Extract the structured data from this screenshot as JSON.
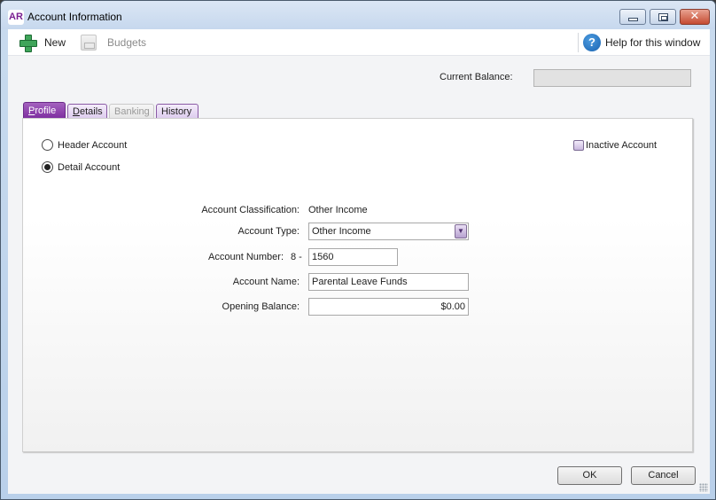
{
  "window": {
    "app_logo": "AR",
    "title": "Account Information",
    "controls": {
      "minimize": "minimize",
      "maximize": "maximize",
      "close": "✕"
    }
  },
  "toolbar": {
    "new_label": "New",
    "budgets_label": "Budgets",
    "help_label": "Help for this window",
    "help_glyph": "?"
  },
  "balance": {
    "label": "Current Balance:",
    "value": ""
  },
  "tabs": [
    {
      "label": "Profile",
      "mnemonic": "P",
      "rest": "rofile",
      "state": "active"
    },
    {
      "label": "Details",
      "mnemonic": "D",
      "rest": "etails",
      "state": "normal"
    },
    {
      "label": "Banking",
      "state": "disabled"
    },
    {
      "label": "History",
      "state": "normal"
    }
  ],
  "profile": {
    "radios": [
      {
        "label": "Header Account",
        "checked": false
      },
      {
        "label": "Detail Account",
        "checked": true
      }
    ],
    "inactive_label": "Inactive Account",
    "inactive_checked": false,
    "classification_label": "Account Classification:",
    "classification_value": "Other Income",
    "type_label": "Account Type:",
    "type_value": "Other Income",
    "number_label": "Account Number:",
    "number_prefix": "8 -",
    "number_value": "1560",
    "name_label": "Account Name:",
    "name_value": "Parental Leave Funds",
    "opening_label": "Opening Balance:",
    "opening_value": "$0.00"
  },
  "footer": {
    "ok_label": "OK",
    "cancel_label": "Cancel"
  }
}
